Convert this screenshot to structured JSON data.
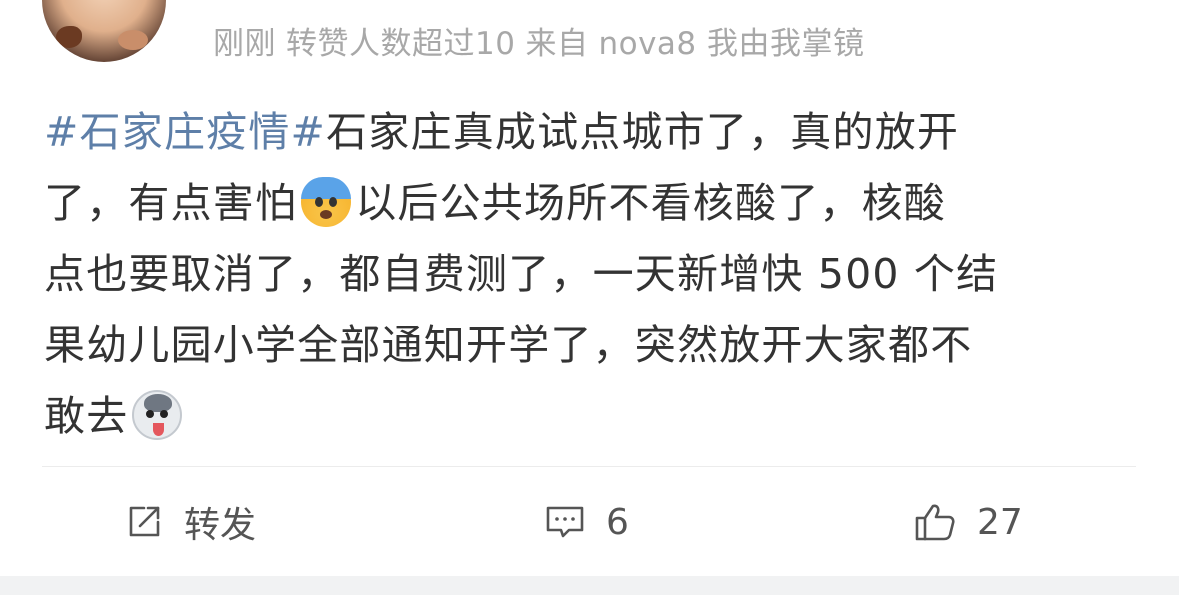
{
  "header": {
    "time": "刚刚",
    "repost_info": "转赞人数超过10",
    "source": "来自",
    "device": "nova8 我由我掌镜"
  },
  "post": {
    "topic": "#石家庄疫情#",
    "line1": "石家庄真成试点城市了，真的放开",
    "line2a": "了，有点害怕",
    "line2b": "以后公共场所不看核酸了，核酸",
    "line3": "点也要取消了，都自费测了，一天新增快 500 个结",
    "line4": "果幼儿园小学全部通知开学了，突然放开大家都不",
    "line5": "敢去",
    "emojis": [
      "fearful-face-emoji",
      "husky-dog-emoji"
    ]
  },
  "actions": {
    "repost_label": "转发",
    "comment_count": "6",
    "like_count": "27"
  },
  "colors": {
    "topic": "#5e7fa8",
    "text": "#333333",
    "meta": "#a8a8a8"
  }
}
